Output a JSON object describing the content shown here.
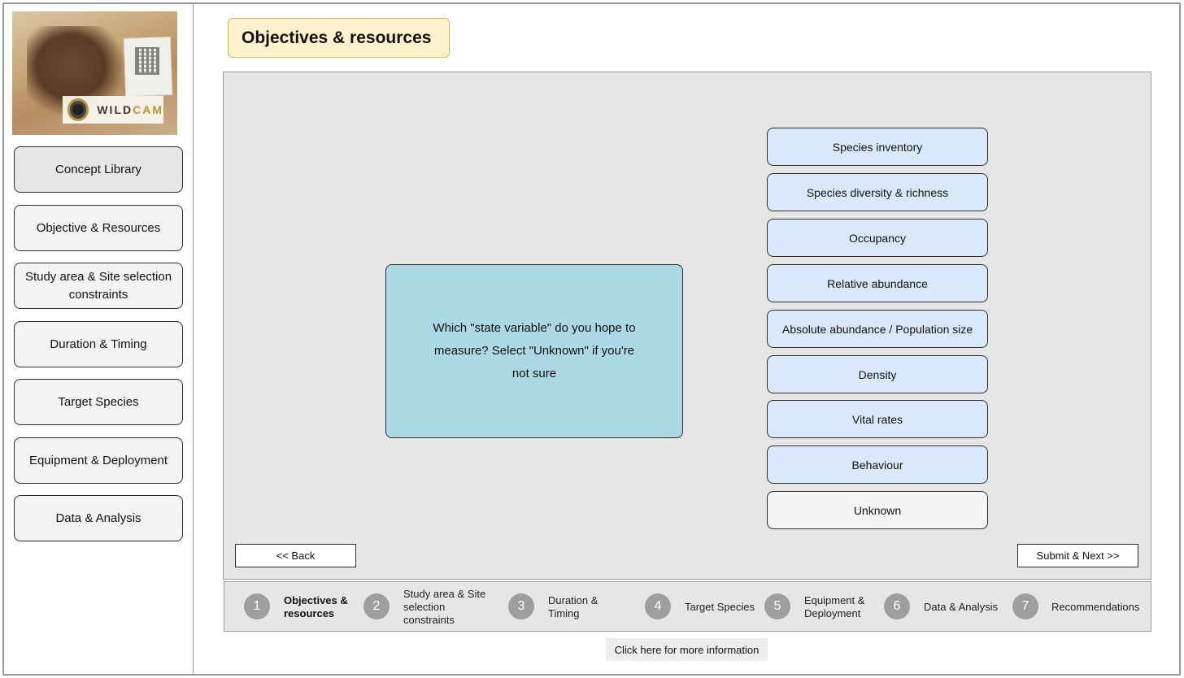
{
  "title": "Objectives & resources",
  "brand": {
    "name_prefix": "WILD",
    "name_suffix": "CAM"
  },
  "sidebar": {
    "items": [
      {
        "label": "Concept Library"
      },
      {
        "label": "Objective & Resources"
      },
      {
        "label": "Study area & Site selection constraints"
      },
      {
        "label": "Duration & Timing"
      },
      {
        "label": "Target Species"
      },
      {
        "label": "Equipment & Deployment"
      },
      {
        "label": "Data & Analysis"
      }
    ]
  },
  "main": {
    "question": "Which \"state variable\" do you hope to measure? Select \"Unknown\" if you're not sure",
    "options": [
      {
        "label": "Species inventory"
      },
      {
        "label": "Species diversity & richness"
      },
      {
        "label": "Occupancy"
      },
      {
        "label": "Relative abundance"
      },
      {
        "label": "Absolute abundance / Population size"
      },
      {
        "label": "Density"
      },
      {
        "label": "Vital rates"
      },
      {
        "label": "Behaviour"
      },
      {
        "label": "Unknown"
      }
    ],
    "back_label": "<< Back",
    "next_label": "Submit & Next >>"
  },
  "stepper": {
    "steps": [
      {
        "num": "1",
        "label": "Objectives & resources"
      },
      {
        "num": "2",
        "label": "Study area & Site selection constraints"
      },
      {
        "num": "3",
        "label": "Duration & Timing"
      },
      {
        "num": "4",
        "label": "Target Species"
      },
      {
        "num": "5",
        "label": "Equipment & Deployment"
      },
      {
        "num": "6",
        "label": "Data & Analysis"
      },
      {
        "num": "7",
        "label": "Recommendations"
      }
    ]
  },
  "more_info_label": "Click here for more information",
  "colors": {
    "title_bg": "#fff2cc",
    "question_bg": "#add8e6",
    "option_bg": "#dae8fc",
    "panel_bg": "#e6e6e6",
    "step_circle": "#9e9e9e"
  }
}
